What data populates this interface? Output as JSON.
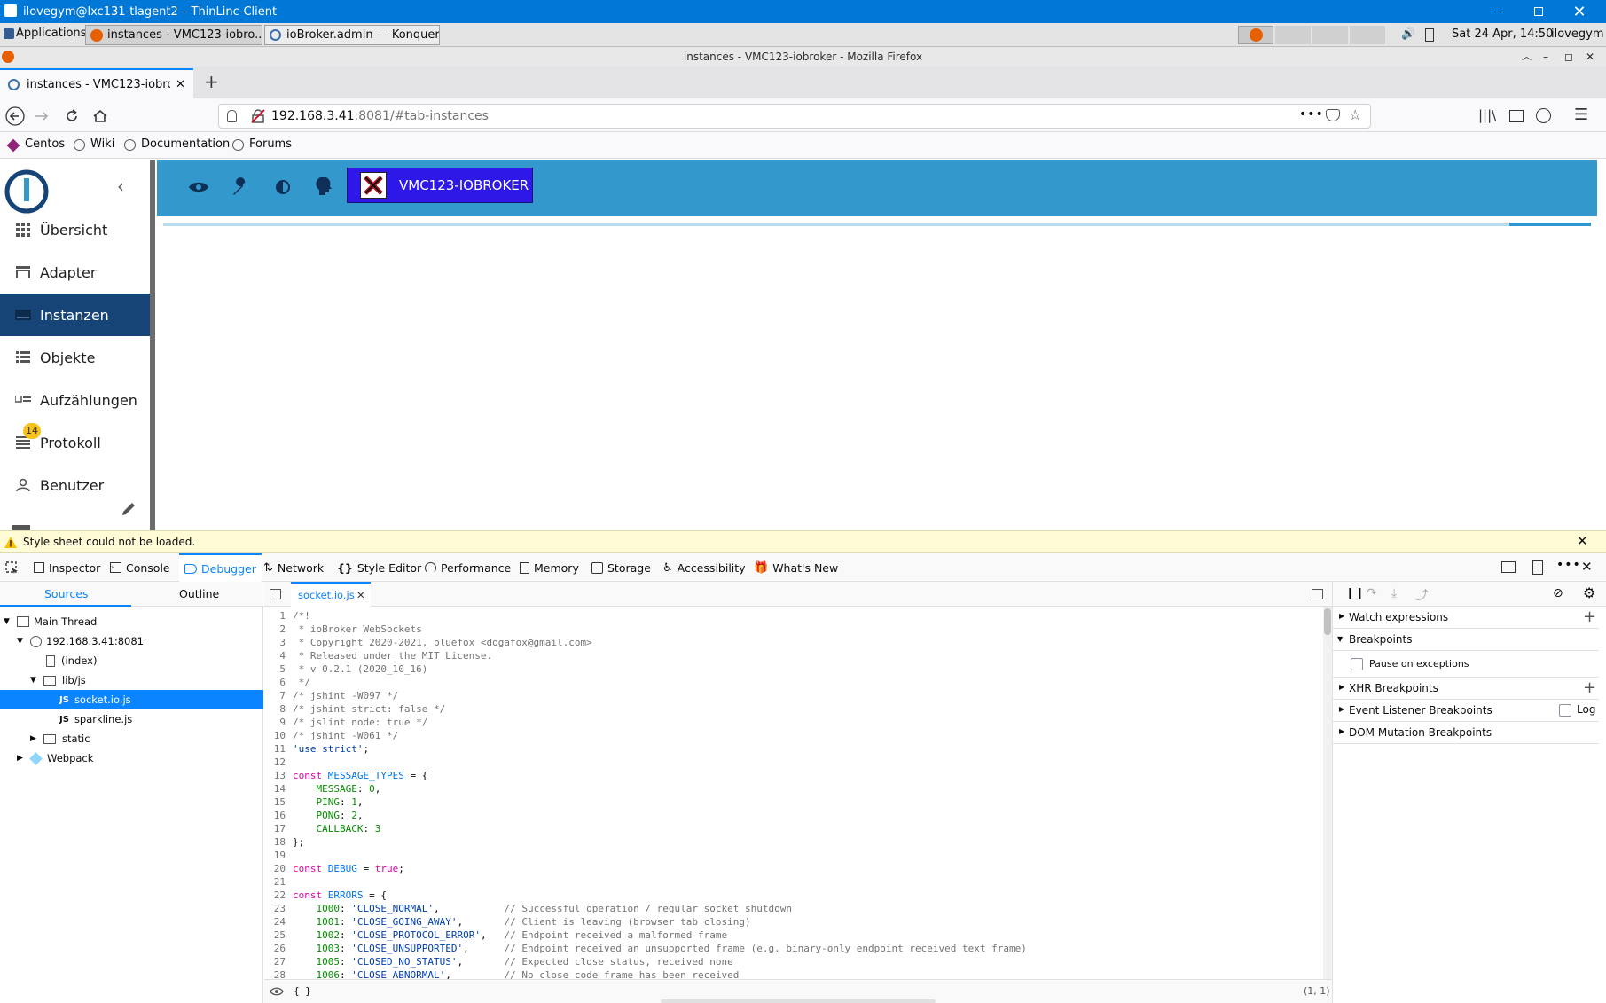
{
  "thinlinc": {
    "title": "ilovegym@lxc131-tlagent2 – ThinLinc-Client"
  },
  "panel": {
    "applications": "Applications",
    "tasks": [
      "instances - VMC123-iobro...",
      "ioBroker.admin — Konqueror"
    ],
    "clock": "Sat 24 Apr, 14:50",
    "user": "ilovegym"
  },
  "firefox": {
    "window_title": "instances - VMC123-iobroker - Mozilla Firefox",
    "tab_title": "instances - VMC123-iobroke",
    "url_host": "192.168.3.41",
    "url_rest": ":8081/#tab-instances",
    "bookmarks": [
      "Centos",
      "Wiki",
      "Documentation",
      "Forums"
    ]
  },
  "app": {
    "nav": [
      {
        "label": "Übersicht",
        "icon": "grid-icon"
      },
      {
        "label": "Adapter",
        "icon": "store-icon"
      },
      {
        "label": "Instanzen",
        "icon": "instances-icon"
      },
      {
        "label": "Objekte",
        "icon": "list-icon"
      },
      {
        "label": "Aufzählungen",
        "icon": "enums-icon"
      },
      {
        "label": "Protokoll",
        "icon": "log-icon",
        "badge": "14"
      },
      {
        "label": "Benutzer",
        "icon": "user-icon"
      }
    ],
    "host_button": "VMC123-IOBROKER"
  },
  "devtools": {
    "notice": "Style sheet could not be loaded.",
    "tabs": [
      "Inspector",
      "Console",
      "Debugger",
      "Network",
      "Style Editor",
      "Performance",
      "Memory",
      "Storage",
      "Accessibility",
      "What's New"
    ],
    "sources_tab": "Sources",
    "outline_tab": "Outline",
    "tree": {
      "main_thread": "Main Thread",
      "host": "192.168.3.41:8081",
      "index": "(index)",
      "libjs": "lib/js",
      "socket": "socket.io.js",
      "sparkline": "sparkline.js",
      "static": "static",
      "webpack": "Webpack"
    },
    "editor_tab": "socket.io.js",
    "footer_left": "{ }",
    "cursor_pos": "(1, 1)",
    "right": {
      "watch": "Watch expressions",
      "breakpoints": "Breakpoints",
      "pause_exceptions": "Pause on exceptions",
      "xhr": "XHR Breakpoints",
      "event_listener": "Event Listener Breakpoints",
      "log": "Log",
      "dom_mutation": "DOM Mutation Breakpoints"
    },
    "code": [
      {
        "n": "1",
        "t": "/*!",
        "c": "cm"
      },
      {
        "n": "2",
        "t": " * ioBroker WebSockets",
        "c": "cm"
      },
      {
        "n": "3",
        "t": " * Copyright 2020-2021, bluefox <dogafox@gmail.com>",
        "c": "cm"
      },
      {
        "n": "4",
        "t": " * Released under the MIT License.",
        "c": "cm"
      },
      {
        "n": "5",
        "t": " * v 0.2.1 (2020_10_16)",
        "c": "cm"
      },
      {
        "n": "6",
        "t": " */",
        "c": "cm"
      },
      {
        "n": "7",
        "t": "/* jshint -W097 */",
        "c": "cm"
      },
      {
        "n": "8",
        "t": "/* jshint strict: false */",
        "c": "cm"
      },
      {
        "n": "9",
        "t": "/* jslint node: true */",
        "c": "cm"
      },
      {
        "n": "10",
        "t": "/* jshint -W061 */",
        "c": "cm"
      },
      {
        "n": "11",
        "t": "'use strict';",
        "c": "str"
      },
      {
        "n": "12",
        "t": "",
        "c": ""
      },
      {
        "n": "13",
        "t": "const MESSAGE_TYPES = {",
        "c": "decl"
      },
      {
        "n": "14",
        "t": "    MESSAGE: 0,",
        "c": "prop"
      },
      {
        "n": "15",
        "t": "    PING: 1,",
        "c": "prop"
      },
      {
        "n": "16",
        "t": "    PONG: 2,",
        "c": "prop"
      },
      {
        "n": "17",
        "t": "    CALLBACK: 3",
        "c": "prop"
      },
      {
        "n": "18",
        "t": "};",
        "c": ""
      },
      {
        "n": "19",
        "t": "",
        "c": ""
      },
      {
        "n": "20",
        "t": "const DEBUG = true;",
        "c": "decl"
      },
      {
        "n": "21",
        "t": "",
        "c": ""
      },
      {
        "n": "22",
        "t": "const ERRORS = {",
        "c": "decl"
      },
      {
        "n": "23",
        "t": "    1000: 'CLOSE_NORMAL',           // Successful operation / regular socket shutdown",
        "c": "err"
      },
      {
        "n": "24",
        "t": "    1001: 'CLOSE_GOING_AWAY',       // Client is leaving (browser tab closing)",
        "c": "err"
      },
      {
        "n": "25",
        "t": "    1002: 'CLOSE_PROTOCOL_ERROR',   // Endpoint received a malformed frame",
        "c": "err"
      },
      {
        "n": "26",
        "t": "    1003: 'CLOSE_UNSUPPORTED',      // Endpoint received an unsupported frame (e.g. binary-only endpoint received text frame)",
        "c": "err"
      },
      {
        "n": "27",
        "t": "    1005: 'CLOSED_NO_STATUS',       // Expected close status, received none",
        "c": "err"
      },
      {
        "n": "28",
        "t": "    1006: 'CLOSE_ABNORMAL',         // No close code frame has been received",
        "c": "err"
      }
    ]
  }
}
